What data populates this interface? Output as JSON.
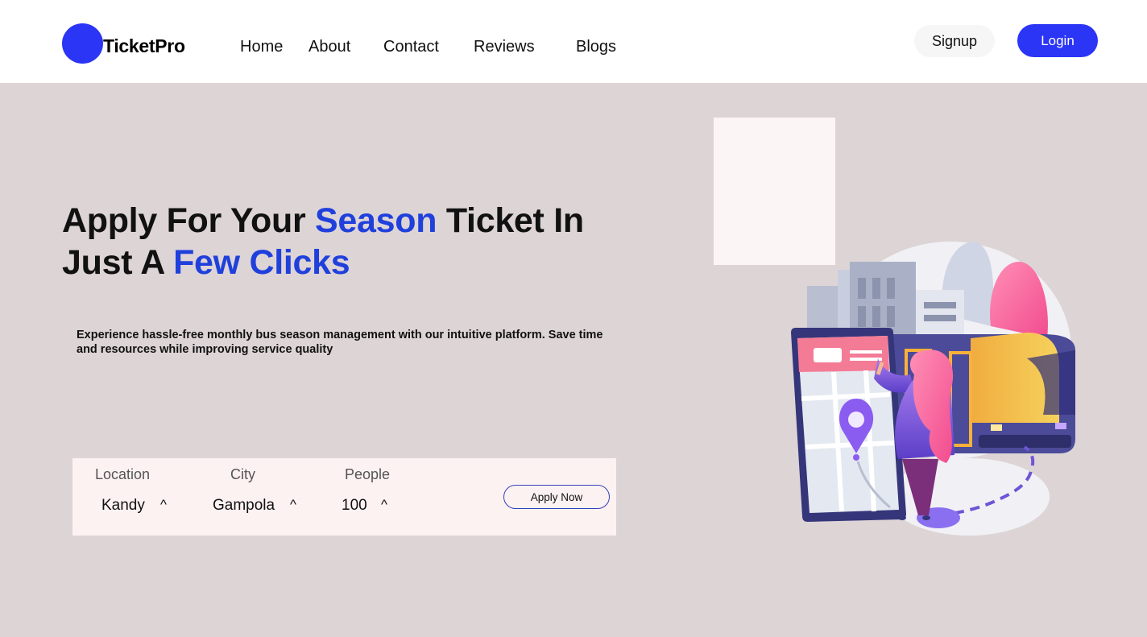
{
  "brand": {
    "name": "TicketPro",
    "logo_color": "#2b35f5"
  },
  "nav": {
    "home": "Home",
    "about": "About",
    "contact": "Contact",
    "reviews": "Reviews",
    "blogs": "Blogs"
  },
  "auth": {
    "signup": "Signup",
    "login": "Login"
  },
  "hero": {
    "title_part1": "Apply For Your ",
    "title_accent1": "Season",
    "title_part2": " Ticket In Just A ",
    "title_accent2": "Few Clicks",
    "accent_color": "#2040dc",
    "subtitle": "Experience hassle-free monthly bus season management with our intuitive platform. Save time and resources while improving service quality"
  },
  "form": {
    "location_label": "Location",
    "location_value": "Kandy",
    "city_label": "City",
    "city_value": "Gampola",
    "people_label": "People",
    "people_value": "100",
    "caret": "^",
    "apply_button": "Apply Now"
  },
  "colors": {
    "background": "#ddd4d6",
    "primary": "#2b35f5",
    "form_bg": "#fdf2f2"
  },
  "icons": [
    "dropdown-caret-icon",
    "bus-ticket-illustration"
  ]
}
